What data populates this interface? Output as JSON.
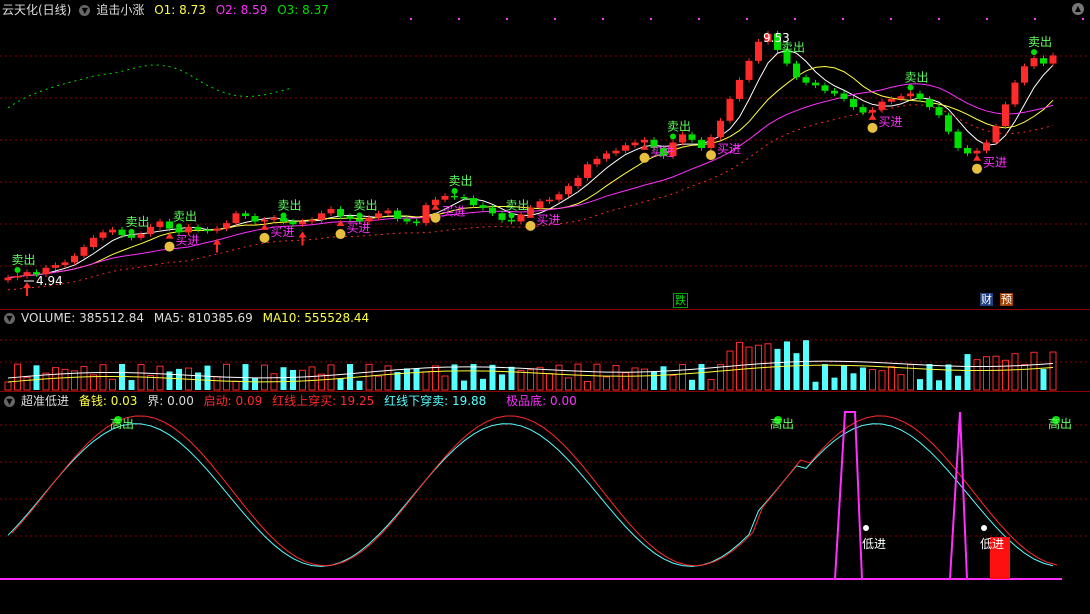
{
  "main": {
    "title": "云天化(日线)",
    "indicator": "追击小涨",
    "o1": "O1: 8.73",
    "o2": "O2: 8.59",
    "o3": "O3: 8.37",
    "high_label": "9.53",
    "low_label": "4.94",
    "badge_die": "跌",
    "badge_cai": "财",
    "badge_yu": "预",
    "sell_label": "卖出",
    "buy_label": "买进"
  },
  "volume": {
    "volume": "VOLUME: 385512.84",
    "ma5": "MA5: 810385.69",
    "ma10": "MA10: 555528.44"
  },
  "osc": {
    "title": "超准低进",
    "beiqian": "备钱: 0.03",
    "jie": "界: 0.00",
    "qidong": "启动: 0.09",
    "red_up": "红线上穿买: 19.25",
    "red_down": "红线下穿卖: 19.88",
    "jipindi": "极品底: 0.00",
    "high_out": "高出",
    "low_in": "低进"
  },
  "colors": {
    "up": "#ff2a2a",
    "down": "#00e000",
    "cyan": "#54ffff",
    "magenta": "#ff30ff",
    "yellow": "#ffff40",
    "grid": "#8b0000"
  },
  "chart_data": {
    "type": "candlestick",
    "price_range": [
      4.94,
      9.53
    ],
    "close": [
      5.02,
      5.05,
      5.12,
      5.08,
      5.2,
      5.25,
      5.3,
      5.42,
      5.58,
      5.75,
      5.85,
      5.9,
      5.8,
      5.75,
      5.82,
      5.95,
      6.05,
      5.92,
      5.85,
      5.95,
      5.9,
      5.88,
      5.92,
      6.02,
      6.2,
      6.15,
      6.05,
      6.08,
      6.12,
      6.05,
      6.0,
      6.05,
      6.08,
      6.2,
      6.28,
      6.15,
      6.1,
      6.05,
      6.12,
      6.2,
      6.25,
      6.1,
      6.05,
      6.02,
      6.35,
      6.45,
      6.52,
      6.5,
      6.48,
      6.35,
      6.3,
      6.2,
      6.08,
      6.05,
      6.18,
      6.3,
      6.42,
      6.45,
      6.55,
      6.7,
      6.85,
      7.1,
      7.2,
      7.3,
      7.35,
      7.45,
      7.5,
      7.55,
      7.4,
      7.25,
      7.5,
      7.65,
      7.55,
      7.4,
      7.6,
      7.9,
      8.3,
      8.65,
      9.0,
      9.35,
      9.5,
      9.2,
      8.95,
      8.7,
      8.6,
      8.55,
      8.45,
      8.4,
      8.3,
      8.15,
      8.05,
      8.1,
      8.25,
      8.3,
      8.35,
      8.4,
      8.3,
      8.15,
      8.0,
      7.7,
      7.4,
      7.3,
      7.35,
      7.5,
      7.8,
      8.2,
      8.6,
      8.9,
      9.05,
      8.95,
      9.1
    ]
  }
}
